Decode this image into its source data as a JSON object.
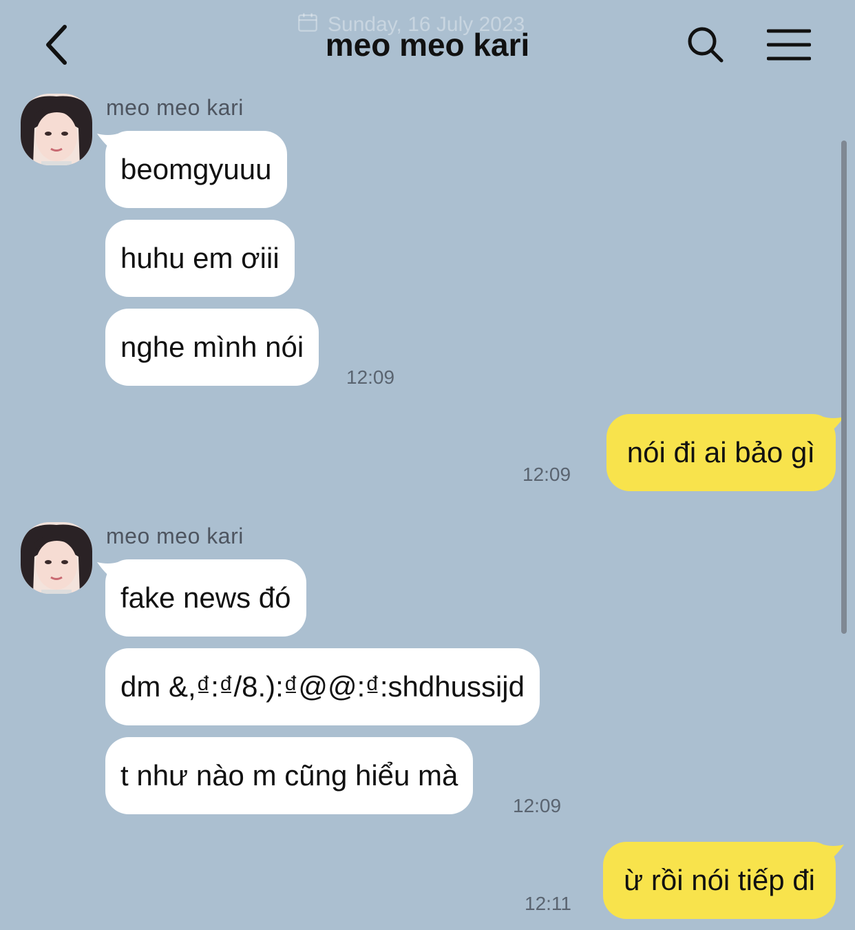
{
  "header": {
    "date_ghost": "Sunday, 16 July 2023",
    "title": "meo meo kari",
    "back_icon": "chevron-left-icon",
    "search_icon": "search-icon",
    "menu_icon": "hamburger-menu-icon"
  },
  "colors": {
    "background": "#abbfd0",
    "incoming_bubble": "#ffffff",
    "outgoing_bubble": "#f8e34c"
  },
  "groups": [
    {
      "sender": "meo meo kari",
      "messages": [
        "beomgyuuu",
        "huhu em ơiii",
        "nghe mình nói"
      ],
      "time": "12:09"
    },
    {
      "outgoing": "nói đi ai bảo gì",
      "time": "12:09"
    },
    {
      "sender": "meo meo kari",
      "messages": [
        "fake news đó",
        "dm &,₫:₫/8.):₫@@:₫:shdhussijd",
        "t như nào m cũng hiểu mà"
      ],
      "time": "12:09"
    },
    {
      "outgoing": "ừ rồi nói tiếp đi",
      "time": "12:11"
    }
  ]
}
